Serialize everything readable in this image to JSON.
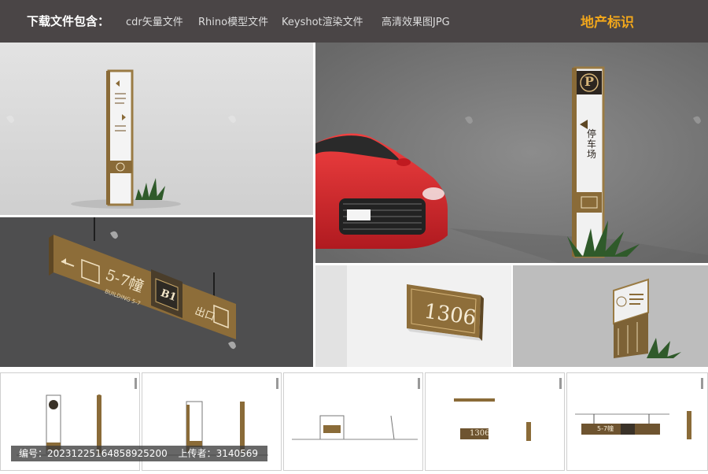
{
  "header": {
    "lead": "下载文件包含：",
    "items": [
      "cdr矢量文件",
      "Rhino模型文件",
      "Keyshot渲染文件",
      "高清效果图JPG"
    ],
    "brand": "地产标识"
  },
  "signs": {
    "hanging_sign_text": "5-7幢",
    "hanging_sign_sub": "BUILDING 5-7",
    "floor_badge": "B1",
    "exit_label": "出口",
    "parking_letter": "P",
    "parking_label": "停车场",
    "room_number": "1306",
    "drawing_room_number": "1306",
    "drawing_hanging_text": "5-7幢"
  },
  "footer": {
    "id_label": "编号：",
    "id_value": "20231225164858925200",
    "uploader_label": "上传者：",
    "uploader_value": "3140569"
  },
  "colors": {
    "topbar": "#4a4546",
    "brand": "#f2a71b",
    "gold": "#9a7b44",
    "car": "#e0232a"
  }
}
